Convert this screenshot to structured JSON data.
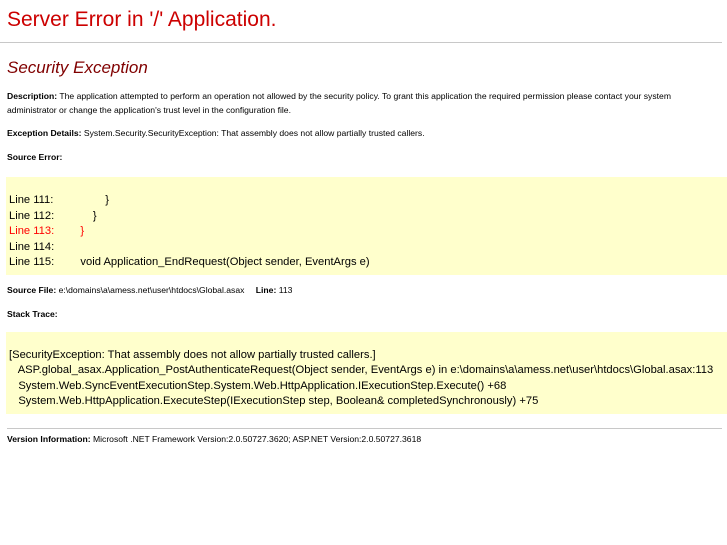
{
  "title": "Server Error in '/' Application.",
  "exception_heading": "Security Exception",
  "description": {
    "label": "Description:",
    "text": "The application attempted to perform an operation not allowed by the security policy.  To grant this application the required permission please contact your system administrator or change the application's trust level in the configuration file."
  },
  "exception_details": {
    "label": "Exception Details:",
    "text": "System.Security.SecurityException: That assembly does not allow partially trusted callers."
  },
  "source_error": {
    "label": "Source Error:",
    "lines": [
      {
        "num": "Line 111:",
        "code": "            }",
        "highlight": false
      },
      {
        "num": "Line 112:",
        "code": "        }",
        "highlight": false
      },
      {
        "num": "Line 113:",
        "code": "    }",
        "highlight": true
      },
      {
        "num": "Line 114:",
        "code": "",
        "highlight": false
      },
      {
        "num": "Line 115:",
        "code": "    void Application_EndRequest(Object sender, EventArgs e)",
        "highlight": false
      }
    ]
  },
  "source_file": {
    "label": "Source File:",
    "path": "e:\\domains\\a\\amess.net\\user\\htdocs\\Global.asax",
    "line_label": "Line:",
    "line": "113"
  },
  "stack_trace": {
    "label": "Stack Trace:",
    "lines": [
      "[SecurityException: That assembly does not allow partially trusted callers.]",
      "   ASP.global_asax.Application_PostAuthenticateRequest(Object sender, EventArgs e) in e:\\domains\\a\\amess.net\\user\\htdocs\\Global.asax:113",
      "   System.Web.SyncEventExecutionStep.System.Web.HttpApplication.IExecutionStep.Execute() +68",
      "   System.Web.HttpApplication.ExecuteStep(IExecutionStep step, Boolean& completedSynchronously) +75"
    ]
  },
  "version_info": {
    "label": "Version Information:",
    "text": "Microsoft .NET Framework Version:2.0.50727.3620; ASP.NET Version:2.0.50727.3618"
  },
  "colors": {
    "title": "#cc0000",
    "heading": "#800000",
    "code_background": "#ffffcc",
    "highlight_line": "#ff0000"
  }
}
